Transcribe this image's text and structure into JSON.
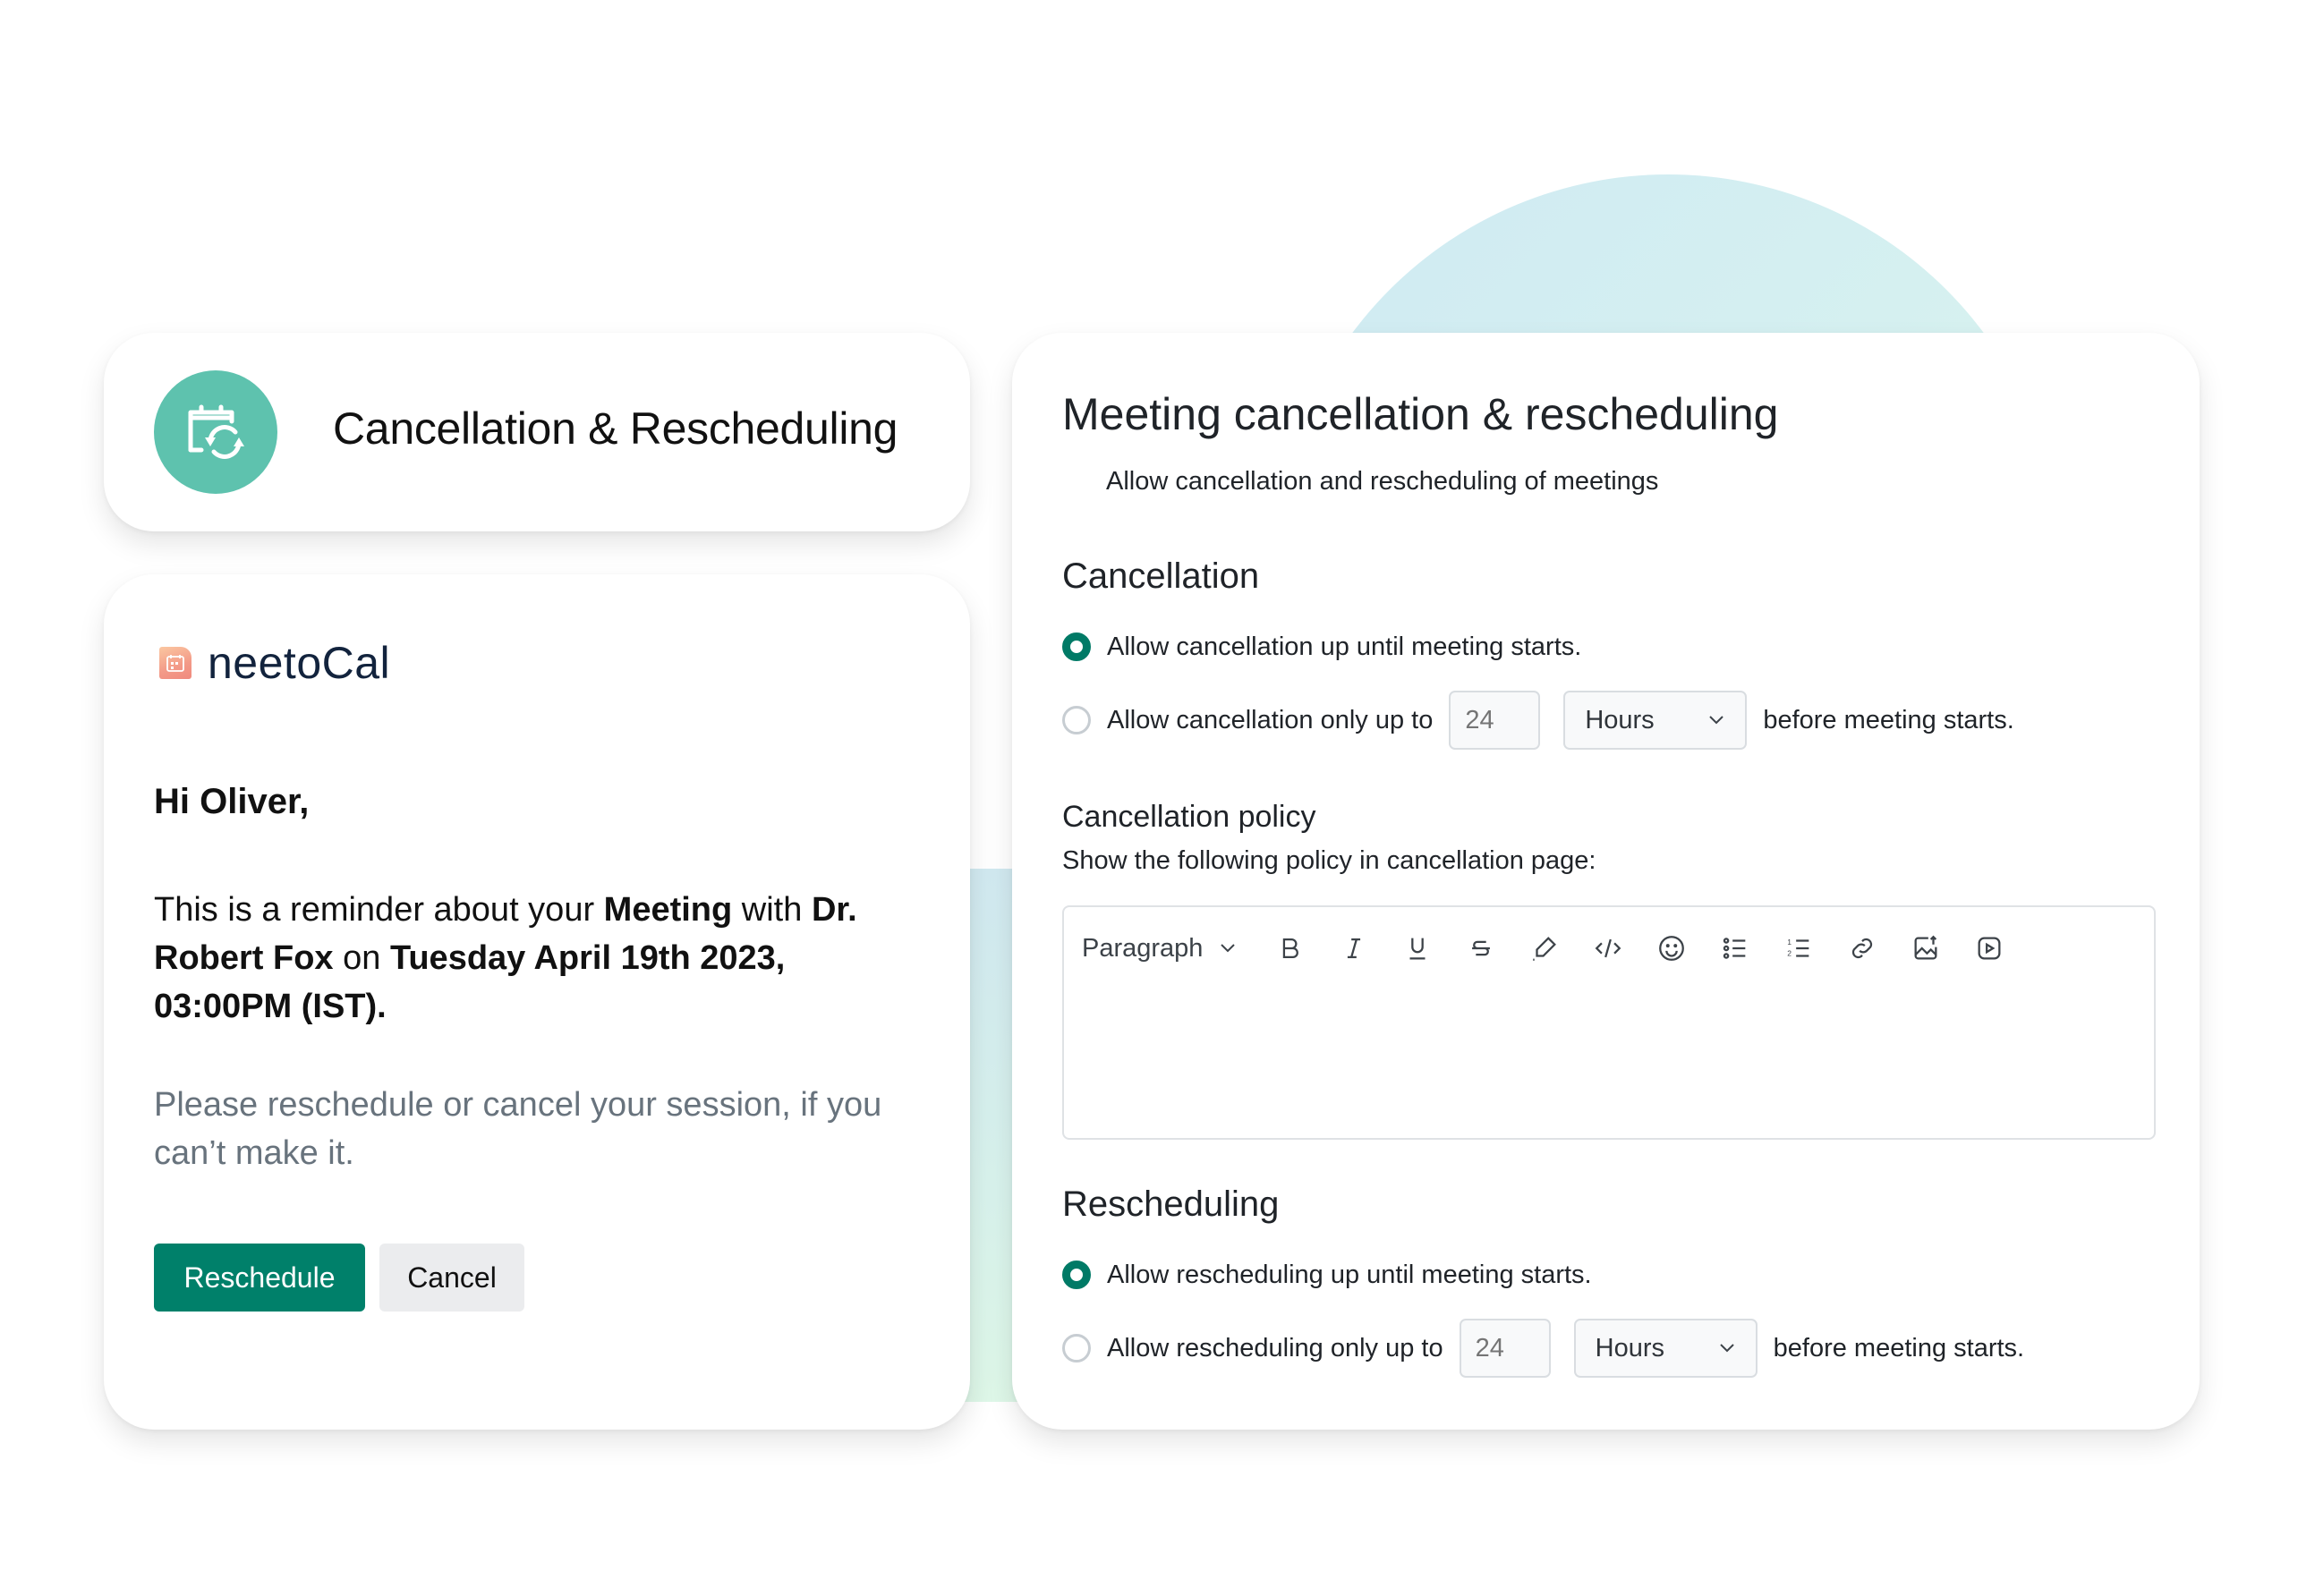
{
  "feature_card": {
    "icon": "calendar-sync-icon",
    "title": "Cancellation & Rescheduling",
    "accent_color": "#5ec2ae"
  },
  "email": {
    "brand": {
      "logo_icon": "neetocal-logo-icon",
      "name": "neetoCal"
    },
    "greeting": "Hi Oliver,",
    "reminder": {
      "prefix": "This is a reminder about your ",
      "meeting_word": "Meeting",
      "with": " with ",
      "host": "Dr. Robert Fox",
      "on": " on ",
      "datetime": "Tuesday April 19th 2023, 03:00PM (IST)."
    },
    "prompt": "Please reschedule or cancel your session, if you can’t make it.",
    "buttons": {
      "reschedule": "Reschedule",
      "cancel": "Cancel"
    },
    "primary_color": "#00806a"
  },
  "settings": {
    "title": "Meeting cancellation & rescheduling",
    "subtitle": "Allow cancellation and rescheduling of meetings",
    "cancellation": {
      "heading": "Cancellation",
      "options": [
        {
          "label": "Allow cancellation up until meeting starts.",
          "checked": true
        },
        {
          "label_prefix": "Allow cancellation only up to",
          "amount_placeholder": "24",
          "unit": "Hours",
          "label_suffix": "before meeting starts.",
          "checked": false
        }
      ]
    },
    "policy": {
      "heading": "Cancellation policy",
      "description": "Show the following policy in cancellation page:",
      "editor": {
        "block_type": "Paragraph",
        "tools": [
          "bold-icon",
          "italic-icon",
          "underline-icon",
          "strikethrough-icon",
          "highlight-icon",
          "code-icon",
          "emoji-icon",
          "bullet-list-icon",
          "numbered-list-icon",
          "link-icon",
          "image-upload-icon",
          "video-icon"
        ],
        "content": ""
      }
    },
    "rescheduling": {
      "heading": "Rescheduling",
      "options": [
        {
          "label": "Allow rescheduling up until meeting starts.",
          "checked": true
        },
        {
          "label_prefix": "Allow rescheduling only up to",
          "amount_placeholder": "24",
          "unit": "Hours",
          "label_suffix": "before meeting starts.",
          "checked": false
        }
      ]
    },
    "radio_color": "#007a66"
  }
}
